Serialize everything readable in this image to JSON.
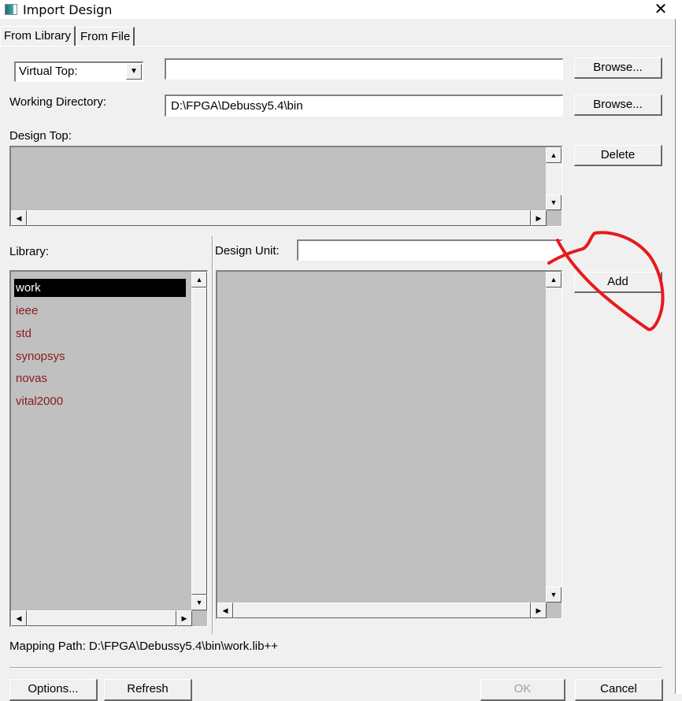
{
  "window": {
    "title": "Import Design",
    "close_icon": "close-icon"
  },
  "tabs": [
    {
      "label": "From Library",
      "active": true
    },
    {
      "label": "From File",
      "active": false
    }
  ],
  "virtual_top": {
    "selected": "Virtual Top:",
    "value": ""
  },
  "browse_label": "Browse...",
  "working_directory": {
    "label": "Working Directory:",
    "value": "D:\\FPGA\\Debussy5.4\\bin"
  },
  "design_top": {
    "label": "Design Top:"
  },
  "delete_label": "Delete",
  "library": {
    "label": "Library:",
    "items": [
      "work",
      "ieee",
      "std",
      "synopsys",
      "novas",
      "vital2000"
    ],
    "selected": "work"
  },
  "design_unit": {
    "label": "Design Unit:",
    "value": ""
  },
  "add_label": "Add",
  "mapping_path": "Mapping Path: D:\\FPGA\\Debussy5.4\\bin\\work.lib++",
  "buttons": {
    "options": "Options...",
    "refresh": "Refresh",
    "ok": "OK",
    "cancel": "Cancel"
  },
  "colors": {
    "library_item": "#8b1a1a",
    "list_bg": "#c0c0c0",
    "annotation": "#e8191c"
  }
}
